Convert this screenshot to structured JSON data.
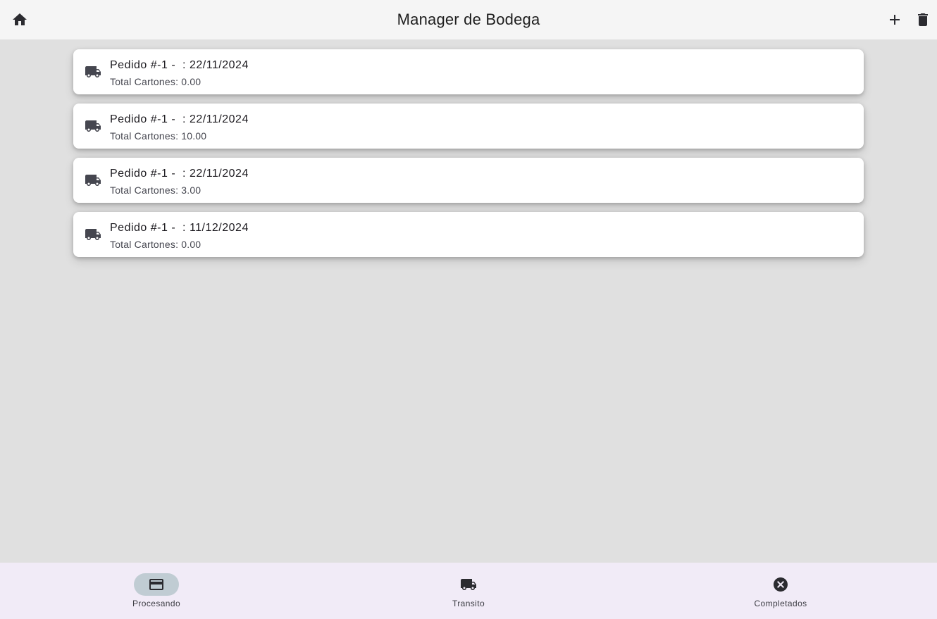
{
  "app_bar": {
    "title": "Manager de Bodega",
    "home_icon": "home-icon",
    "add_icon": "plus-icon",
    "delete_icon": "trash-icon"
  },
  "orders": [
    {
      "title": "Pedido #-1 -  : 22/11/2024",
      "subtitle": "Total Cartones: 0.00",
      "icon": "truck-icon"
    },
    {
      "title": "Pedido #-1 -  : 22/11/2024",
      "subtitle": "Total Cartones: 10.00",
      "icon": "truck-icon"
    },
    {
      "title": "Pedido #-1 -  : 22/11/2024",
      "subtitle": "Total Cartones: 3.00",
      "icon": "truck-icon"
    },
    {
      "title": "Pedido #-1 -  : 11/12/2024",
      "subtitle": "Total Cartones: 0.00",
      "icon": "truck-icon"
    }
  ],
  "bottom_nav": {
    "selected": "Procesando",
    "items": [
      {
        "label": "Procesando",
        "icon": "credit-card-icon"
      },
      {
        "label": "Transito",
        "icon": "truck-icon"
      },
      {
        "label": "Completados",
        "icon": "cancel-circle-icon"
      }
    ]
  },
  "colors": {
    "background": "#e0e0e0",
    "app_bar": "#f5f5f5",
    "card": "#ffffff",
    "bottom_nav": "#f1ebf7",
    "active_indicator": "#c0ccd3"
  }
}
